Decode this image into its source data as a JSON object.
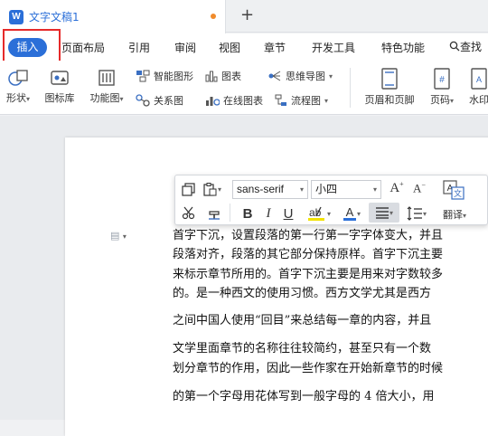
{
  "titlebar": {
    "doc_title": "文字文稿1",
    "new_tab": "+",
    "logo": "W"
  },
  "ribbon": {
    "tabs": [
      {
        "id": "insert",
        "label": "插入",
        "active": true
      },
      {
        "id": "layout",
        "label": "页面布局"
      },
      {
        "id": "references",
        "label": "引用"
      },
      {
        "id": "review",
        "label": "审阅"
      },
      {
        "id": "view",
        "label": "视图"
      },
      {
        "id": "sections",
        "label": "章节"
      },
      {
        "id": "developer",
        "label": "开发工具"
      },
      {
        "id": "features",
        "label": "特色功能"
      }
    ],
    "search_label": "查找"
  },
  "toolbar": {
    "shapes": "形状",
    "icon_library": "图标库",
    "function_chart": "功能图",
    "smart_graphic": "智能图形",
    "chart": "图表",
    "mind_map": "思维导图",
    "relation_map": "关系图",
    "online_chart": "在线图表",
    "flowchart": "流程图",
    "header_footer": "页眉和页脚",
    "page_number": "页码",
    "watermark": "水印"
  },
  "mini_toolbar": {
    "font_family": "sans-serif",
    "font_size": "小四",
    "translate": "翻译"
  },
  "document": {
    "lines": [
      "首字下沉，设置段落的第一行第一字字体变大，并且",
      "段落对齐，段落的其它部分保持原样。首字下沉主要",
      "来标示章节所用的。首字下沉主要是用来对字数较多",
      "的。是一种西文的使用习惯。西方文学尤其是西方",
      "之间中国人使用“回目”来总结每一章的内容，并且",
      "文学里面章节的名称往往较简约，甚至只有一个数",
      "划分章节的作用，因此一些作家在开始新章节的时候",
      "的第一个字母用花体写到一般字母的 4 倍大小，用"
    ]
  },
  "colors": {
    "accent": "#2b6fd8",
    "highlight_border": "#e62a2a",
    "unsaved_dot": "#f08b2c",
    "font_color_a": "#2b6fd8",
    "highlighter": "#f2e200"
  }
}
